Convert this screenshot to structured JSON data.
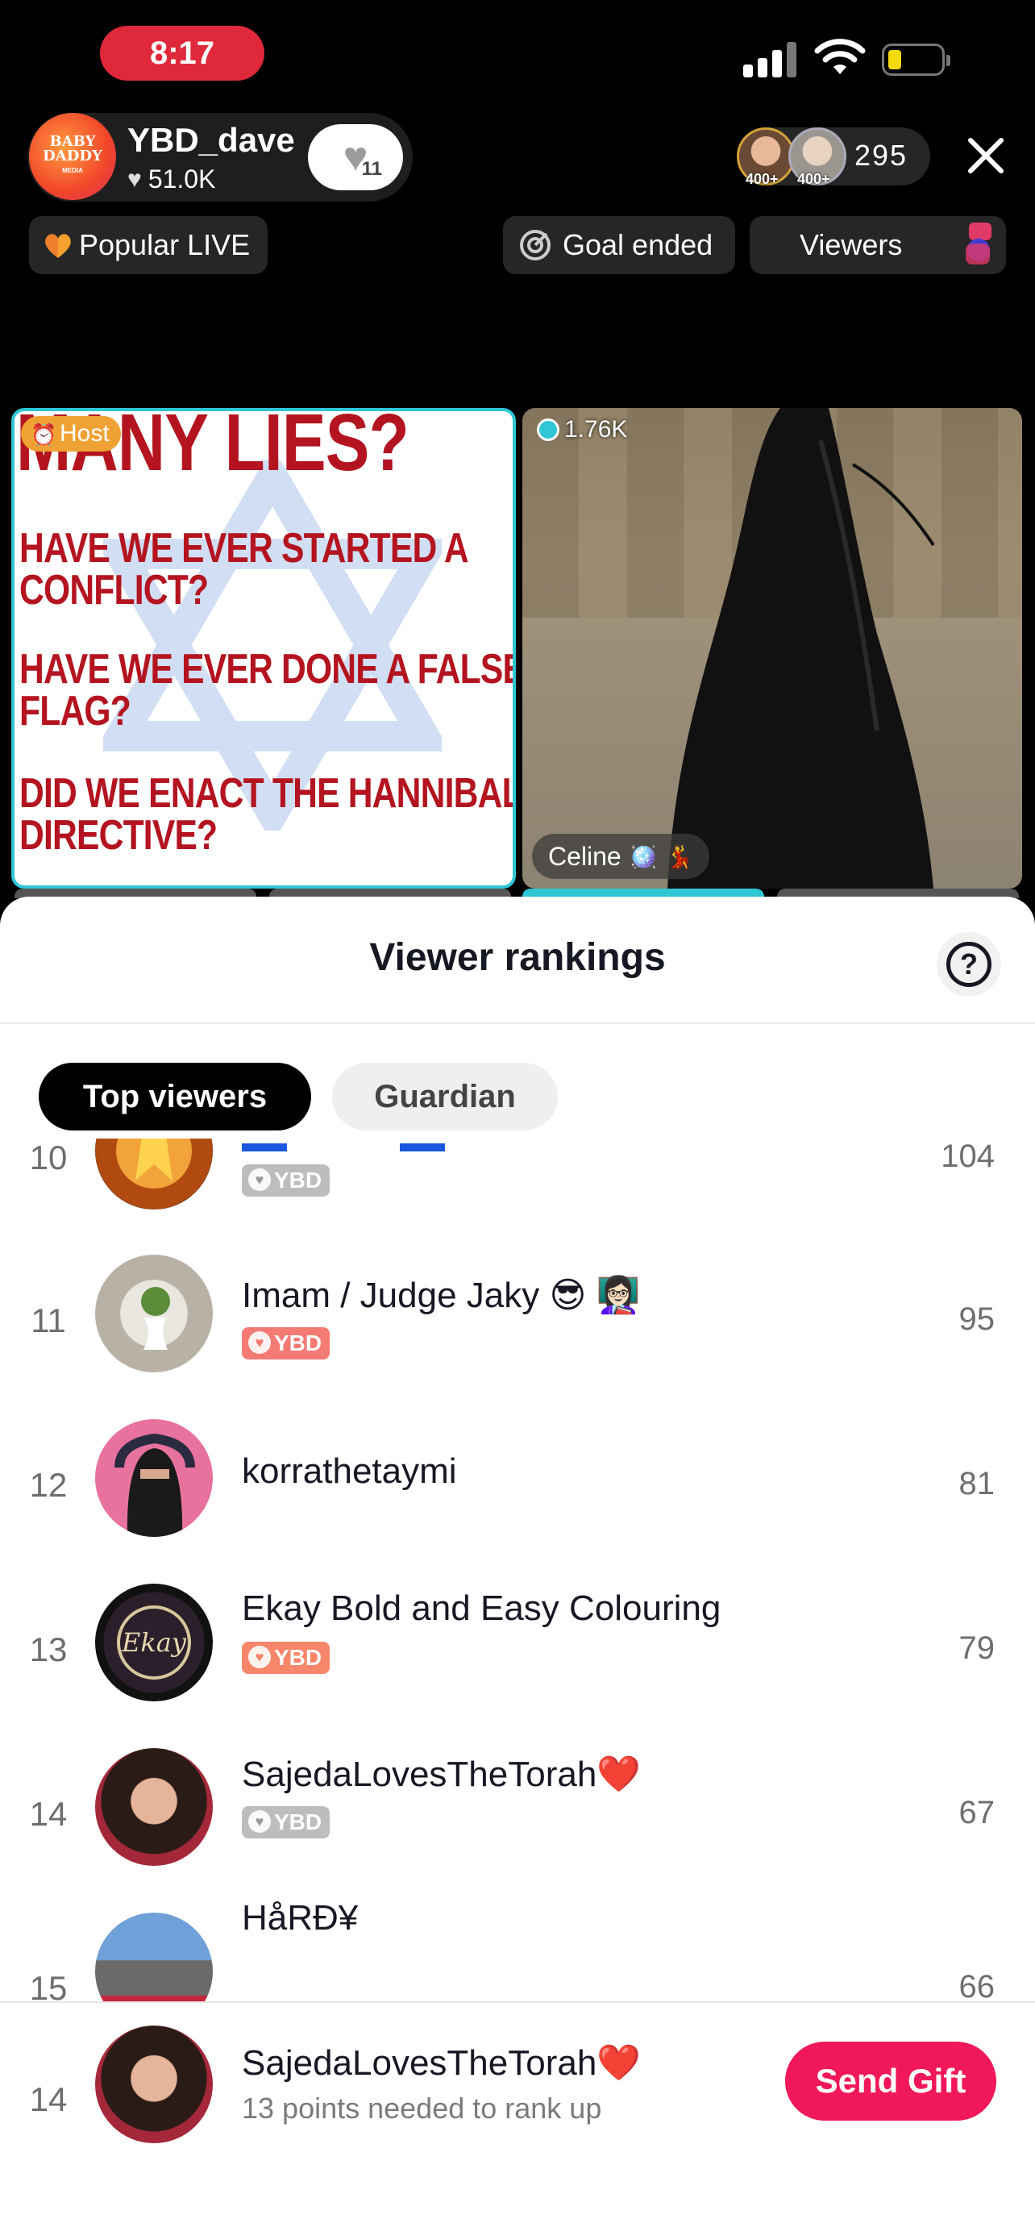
{
  "status_bar": {
    "time": "8:17"
  },
  "host": {
    "name": "YBD_dave",
    "likes": "51.0K",
    "gift_count": "11",
    "avatar_text": "BABY DADDY",
    "avatar_sub": "MEDIA"
  },
  "viewers": {
    "count": "295",
    "avatar_1_badge": "400+",
    "avatar_2_badge": "400+"
  },
  "pills": {
    "popular": "Popular LIVE",
    "goal": "Goal ended",
    "viewers": "Viewers"
  },
  "panels": {
    "left": {
      "badge": "Host",
      "lines": [
        "MANY LIES?",
        "HAVE WE EVER STARTED A",
        "CONFLICT?",
        "HAVE WE EVER DONE A FALSE",
        "FLAG?",
        "DID WE ENACT THE HANNIBAL",
        "DIRECTIVE?"
      ]
    },
    "right": {
      "stat": "1.76K",
      "name": "Celine"
    }
  },
  "sheet": {
    "title": "Viewer rankings",
    "tabs": [
      "Top viewers",
      "Guardian"
    ],
    "rows": [
      {
        "rank": "10",
        "name": "",
        "badge": "YBD",
        "badge_color": "grey",
        "points": "104"
      },
      {
        "rank": "11",
        "name": "Imam / Judge Jaky 😎 👩🏻‍🏫",
        "badge": "YBD",
        "badge_color": "red",
        "points": "95"
      },
      {
        "rank": "12",
        "name": "korrathetaymi",
        "badge": "",
        "badge_color": "",
        "points": "81"
      },
      {
        "rank": "13",
        "name": "Ekay Bold and Easy Colouring",
        "badge": "YBD",
        "badge_color": "orange",
        "points": "79"
      },
      {
        "rank": "14",
        "name": "SajedaLovesTheTorah❤️",
        "badge": "YBD",
        "badge_color": "grey",
        "points": "67"
      },
      {
        "rank": "15",
        "name": "HåRĐ¥",
        "badge": "",
        "badge_color": "",
        "points": "66"
      }
    ],
    "me": {
      "rank": "14",
      "name": "SajedaLovesTheTorah❤️",
      "subtitle": "13 points needed to rank up",
      "button": "Send Gift"
    }
  },
  "colors": {
    "accent": "#f0185a",
    "host_border": "#2fc6d6",
    "time_pill": "#e0283b"
  }
}
